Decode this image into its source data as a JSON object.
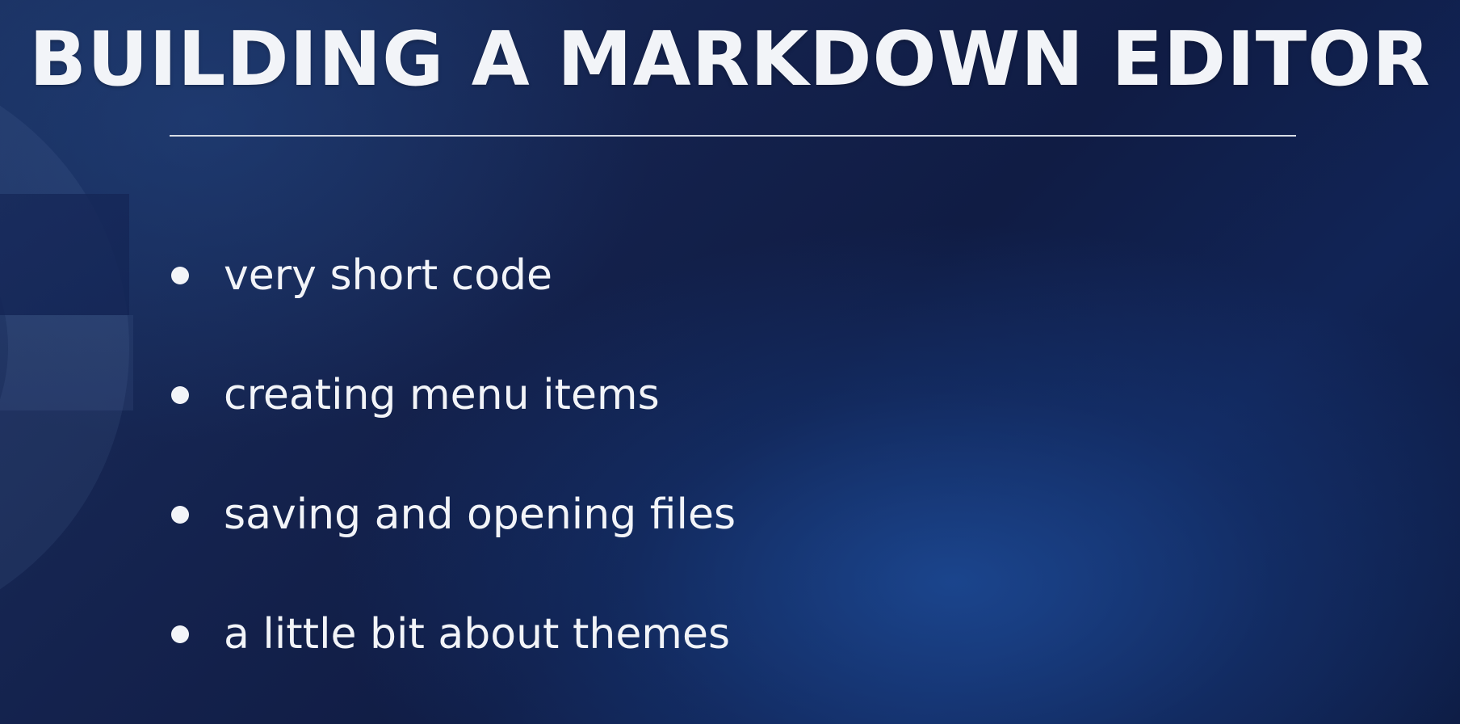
{
  "slide": {
    "title": "BUILDING A MARKDOWN EDITOR",
    "bullets": [
      "very short code",
      "creating menu items",
      "saving and opening files",
      "a little bit about themes"
    ]
  },
  "colors": {
    "background": "#14224d",
    "text": "#f2f4f8",
    "rule": "#d8dde6"
  }
}
